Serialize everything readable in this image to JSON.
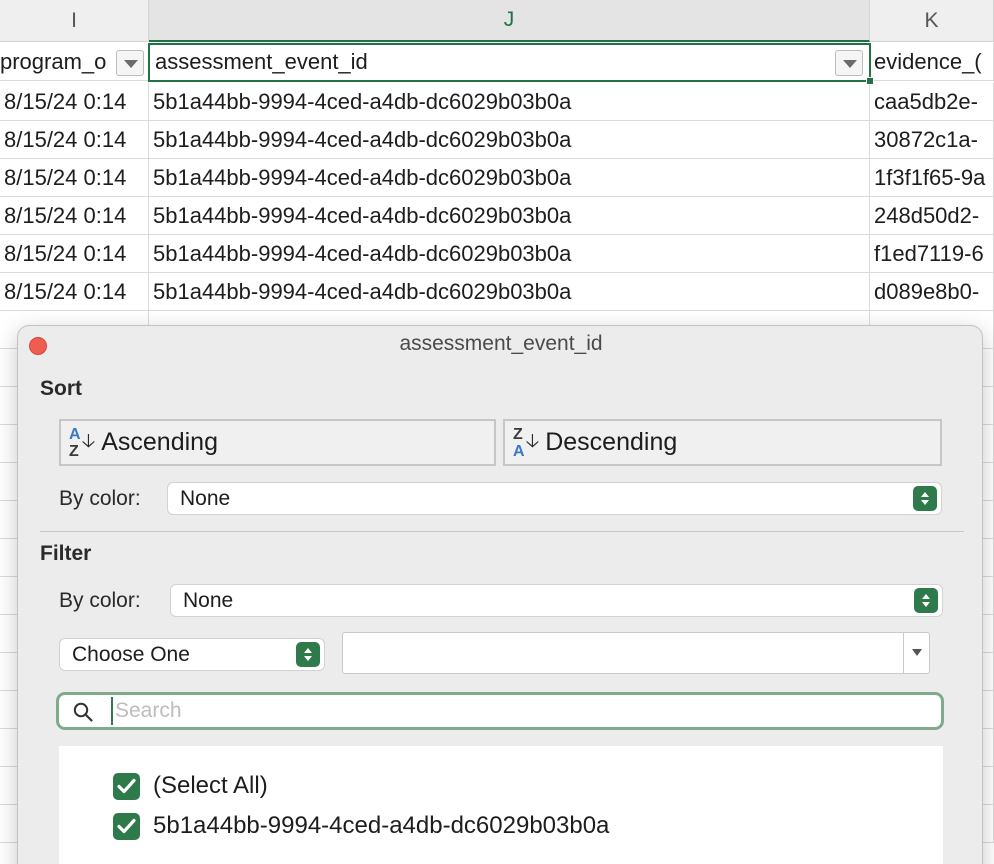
{
  "columns": [
    {
      "letter": "I",
      "header": "program_o"
    },
    {
      "letter": "J",
      "header": "assessment_event_id"
    },
    {
      "letter": "K",
      "header": "evidence_("
    }
  ],
  "rows": [
    {
      "i": "8/15/24 0:14",
      "j": "5b1a44bb-9994-4ced-a4db-dc6029b03b0a",
      "k": "caa5db2e-"
    },
    {
      "i": "8/15/24 0:14",
      "j": "5b1a44bb-9994-4ced-a4db-dc6029b03b0a",
      "k": "30872c1a-"
    },
    {
      "i": "8/15/24 0:14",
      "j": "5b1a44bb-9994-4ced-a4db-dc6029b03b0a",
      "k": "1f3f1f65-9a"
    },
    {
      "i": "8/15/24 0:14",
      "j": "5b1a44bb-9994-4ced-a4db-dc6029b03b0a",
      "k": "248d50d2-"
    },
    {
      "i": "8/15/24 0:14",
      "j": "5b1a44bb-9994-4ced-a4db-dc6029b03b0a",
      "k": "f1ed7119-6"
    },
    {
      "i": "8/15/24 0:14",
      "j": "5b1a44bb-9994-4ced-a4db-dc6029b03b0a",
      "k": "d089e8b0-"
    }
  ],
  "popover": {
    "title": "assessment_event_id",
    "sort": {
      "label": "Sort",
      "ascending_label": "Ascending",
      "ascending_icon": {
        "top": "A",
        "bottom": "Z"
      },
      "descending_label": "Descending",
      "descending_icon": {
        "top": "Z",
        "bottom": "A"
      },
      "by_color_label": "By color:",
      "by_color_value": "None"
    },
    "filter": {
      "label": "Filter",
      "by_color_label": "By color:",
      "by_color_value": "None",
      "condition_value": "Choose One",
      "criteria_value": "",
      "search_placeholder": "Search",
      "items": [
        {
          "label": "(Select All)",
          "checked": true
        },
        {
          "label": "5b1a44bb-9994-4ced-a4db-dc6029b03b0a",
          "checked": true
        }
      ]
    }
  },
  "colors": {
    "accent": "#217346",
    "checkbox": "#2e7a4a",
    "close": "#ee5d50",
    "sort_icon_blue": "#3a78c4"
  }
}
